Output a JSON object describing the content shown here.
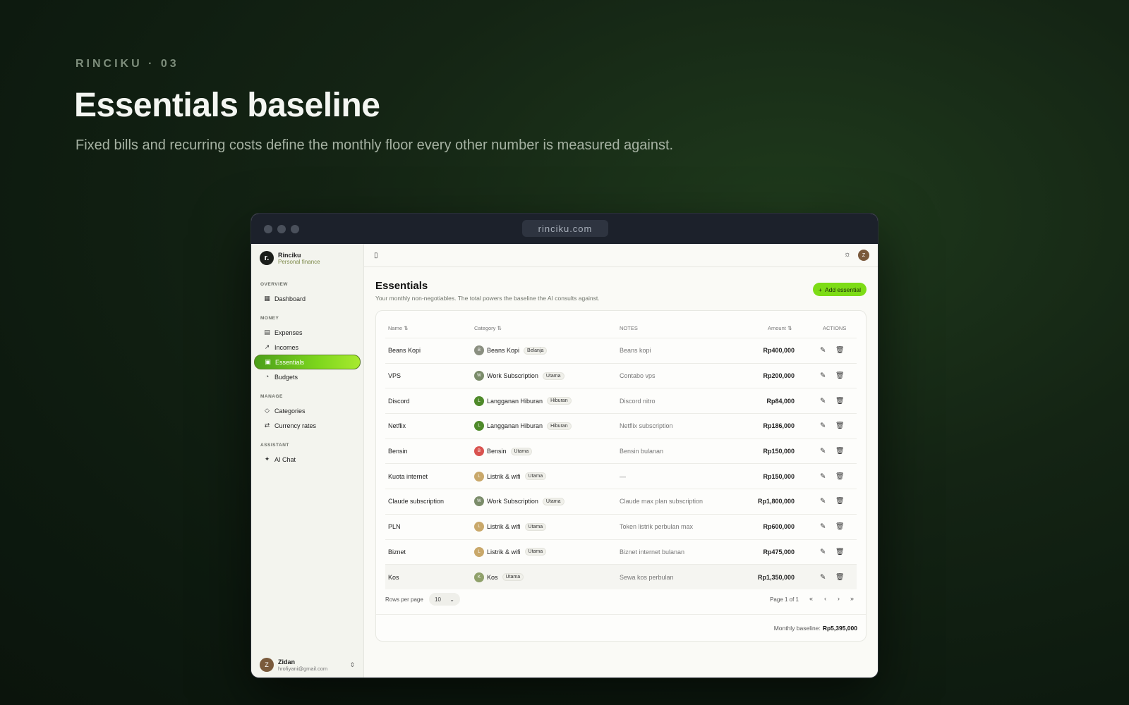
{
  "hero": {
    "eyebrow": "RINCIKU  ·  03",
    "title": "Essentials baseline",
    "subtitle": "Fixed bills and recurring costs define the monthly floor every other number is measured against."
  },
  "browser": {
    "url": "rinciku.com"
  },
  "sidebar": {
    "brand_logo": "r.",
    "brand_name": "Rinciku",
    "brand_sub": "Personal finance",
    "groups": [
      {
        "label": "OVERVIEW",
        "items": [
          {
            "label": "Dashboard",
            "icon": "grid-icon"
          }
        ]
      },
      {
        "label": "MONEY",
        "items": [
          {
            "label": "Expenses",
            "icon": "receipt-icon"
          },
          {
            "label": "Incomes",
            "icon": "trend-up-icon"
          },
          {
            "label": "Essentials",
            "icon": "wallet-icon",
            "active": true
          },
          {
            "label": "Budgets",
            "icon": "piggy-bank-icon"
          }
        ]
      },
      {
        "label": "MANAGE",
        "items": [
          {
            "label": "Categories",
            "icon": "tag-icon"
          },
          {
            "label": "Currency rates",
            "icon": "swap-icon"
          }
        ]
      },
      {
        "label": "ASSISTANT",
        "items": [
          {
            "label": "AI Chat",
            "icon": "sparkle-icon"
          }
        ]
      }
    ],
    "user": {
      "initial": "Z",
      "name": "Zidan",
      "email": "hrofiyani@gmail.com"
    }
  },
  "topbar": {
    "avatar_initial": "Z"
  },
  "page": {
    "title": "Essentials",
    "description": "Your monthly non-negotiables. The total powers the baseline the AI consults against.",
    "add_label": "Add essential"
  },
  "table": {
    "columns": {
      "name": "Name",
      "category": "Category",
      "notes": "NOTES",
      "amount": "Amount",
      "actions": "ACTIONS"
    },
    "rows": [
      {
        "name": "Beans Kopi",
        "cat_initial": "B",
        "cat_color": "#8a8f80",
        "category": "Beans Kopi",
        "tag": "Belanja",
        "notes": "Beans kopi",
        "amount": "Rp400,000"
      },
      {
        "name": "VPS",
        "cat_initial": "W",
        "cat_color": "#7b8c6a",
        "category": "Work Subscription",
        "tag": "Utama",
        "notes": "Contabo vps",
        "amount": "Rp200,000"
      },
      {
        "name": "Discord",
        "cat_initial": "L",
        "cat_color": "#4f8a2a",
        "category": "Langganan Hiburan",
        "tag": "Hiburan",
        "notes": "Discord nitro",
        "amount": "Rp84,000"
      },
      {
        "name": "Netflix",
        "cat_initial": "L",
        "cat_color": "#4f8a2a",
        "category": "Langganan Hiburan",
        "tag": "Hiburan",
        "notes": "Netflix subscription",
        "amount": "Rp186,000"
      },
      {
        "name": "Bensin",
        "cat_initial": "B",
        "cat_color": "#d9534f",
        "category": "Bensin",
        "tag": "Utama",
        "notes": "Bensin bulanan",
        "amount": "Rp150,000"
      },
      {
        "name": "Kuota internet",
        "cat_initial": "L",
        "cat_color": "#c9a86a",
        "category": "Listrik & wifi",
        "tag": "Utama",
        "notes": "—",
        "amount": "Rp150,000"
      },
      {
        "name": "Claude subscription",
        "cat_initial": "W",
        "cat_color": "#7b8c6a",
        "category": "Work Subscription",
        "tag": "Utama",
        "notes": "Claude max plan subscription",
        "amount": "Rp1,800,000"
      },
      {
        "name": "PLN",
        "cat_initial": "L",
        "cat_color": "#c9a86a",
        "category": "Listrik & wifi",
        "tag": "Utama",
        "notes": "Token listrik perbulan max",
        "amount": "Rp600,000"
      },
      {
        "name": "Biznet",
        "cat_initial": "L",
        "cat_color": "#c9a86a",
        "category": "Listrik & wifi",
        "tag": "Utama",
        "notes": "Biznet internet bulanan",
        "amount": "Rp475,000"
      },
      {
        "name": "Kos",
        "cat_initial": "K",
        "cat_color": "#8fa06a",
        "category": "Kos",
        "tag": "Utama",
        "notes": "Sewa kos perbulan",
        "amount": "Rp1,350,000"
      }
    ]
  },
  "pager": {
    "rows_label": "Rows per page",
    "rows_value": "10",
    "page_info": "Page 1 of 1"
  },
  "footer": {
    "label": "Monthly baseline:",
    "value": "Rp5,395,000"
  },
  "colors": {
    "accent": "#7ddc16",
    "active_nav": "#5fb81c"
  }
}
